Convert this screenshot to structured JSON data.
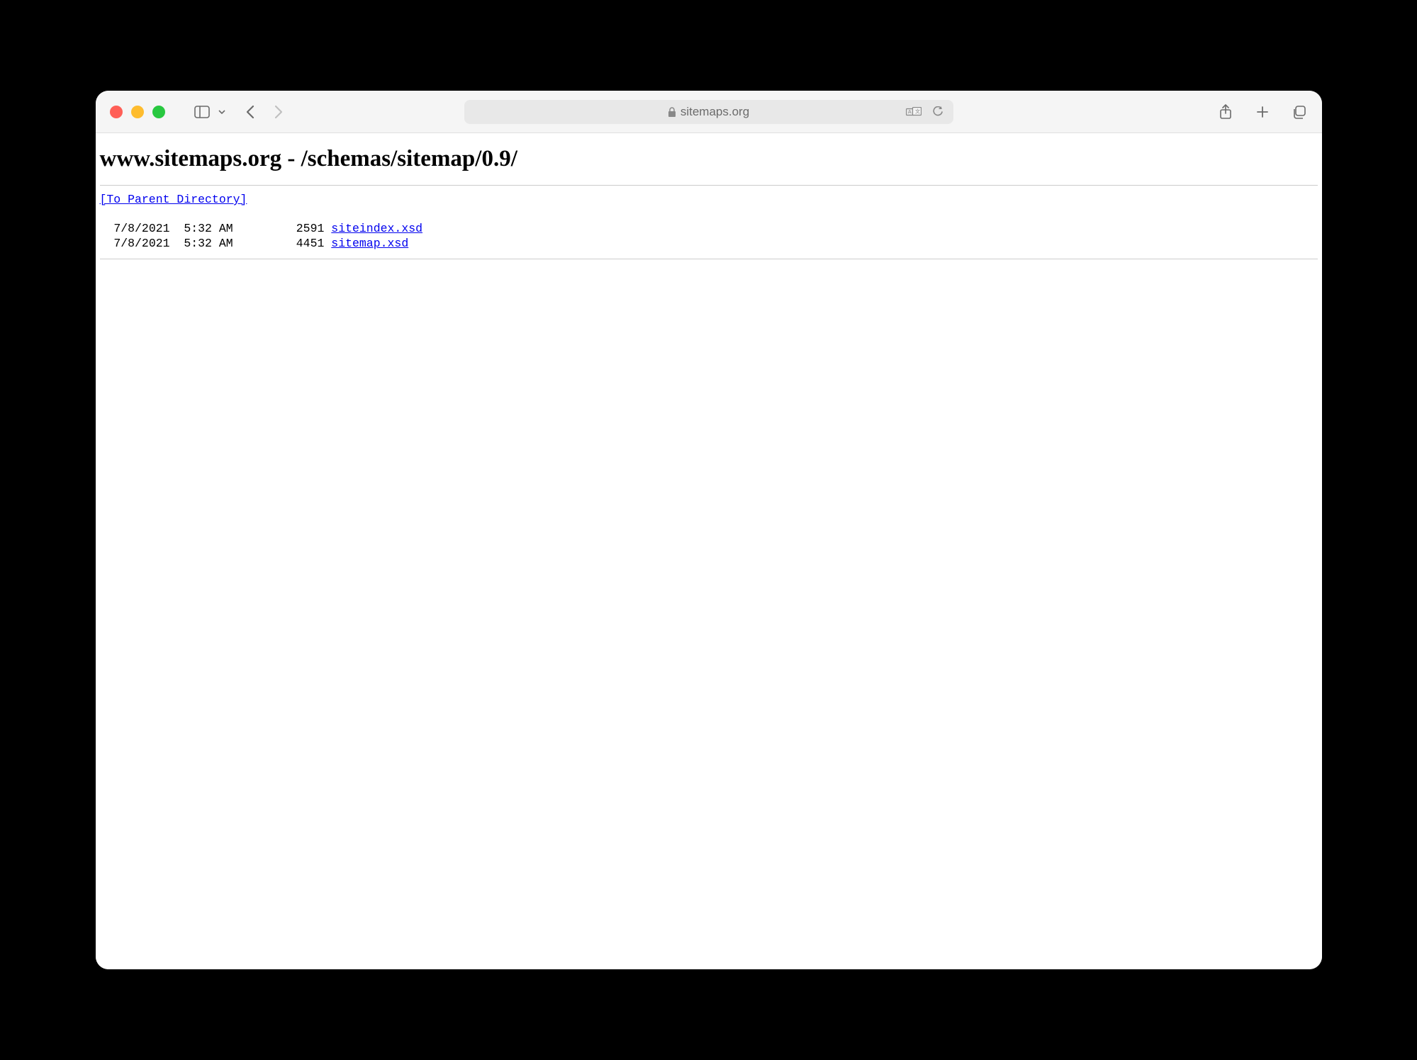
{
  "toolbar": {
    "address": {
      "domain": "sitemaps.org"
    }
  },
  "page": {
    "heading": "www.sitemaps.org - /schemas/sitemap/0.9/",
    "parent_link": "[To Parent Directory]",
    "listing": {
      "rows": [
        {
          "date": "7/8/2021",
          "time": "5:32 AM",
          "size": "2591",
          "name": "siteindex.xsd"
        },
        {
          "date": "7/8/2021",
          "time": "5:32 AM",
          "size": "4451",
          "name": "sitemap.xsd"
        }
      ]
    }
  }
}
